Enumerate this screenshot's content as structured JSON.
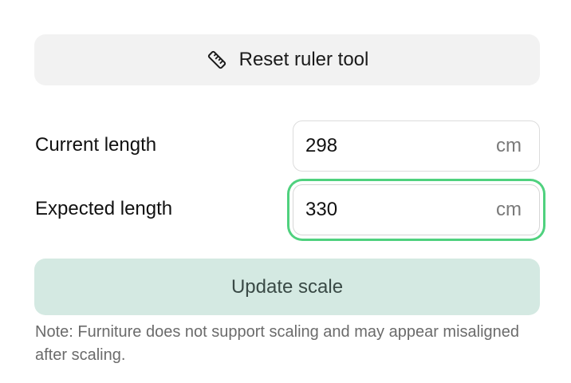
{
  "reset_button": {
    "label": "Reset ruler tool",
    "icon": "ruler-icon"
  },
  "current_length": {
    "label": "Current length",
    "value": "298",
    "unit": "cm"
  },
  "expected_length": {
    "label": "Expected length",
    "value": "330",
    "unit": "cm",
    "focused": true
  },
  "update_button": {
    "label": "Update scale"
  },
  "note": {
    "text": "Note: Furniture does not support scaling and may appear misaligned after scaling."
  },
  "colors": {
    "focus_ring": "#4fd17e",
    "update_button_bg": "#d4e9e2",
    "reset_button_bg": "#f2f2f2"
  }
}
